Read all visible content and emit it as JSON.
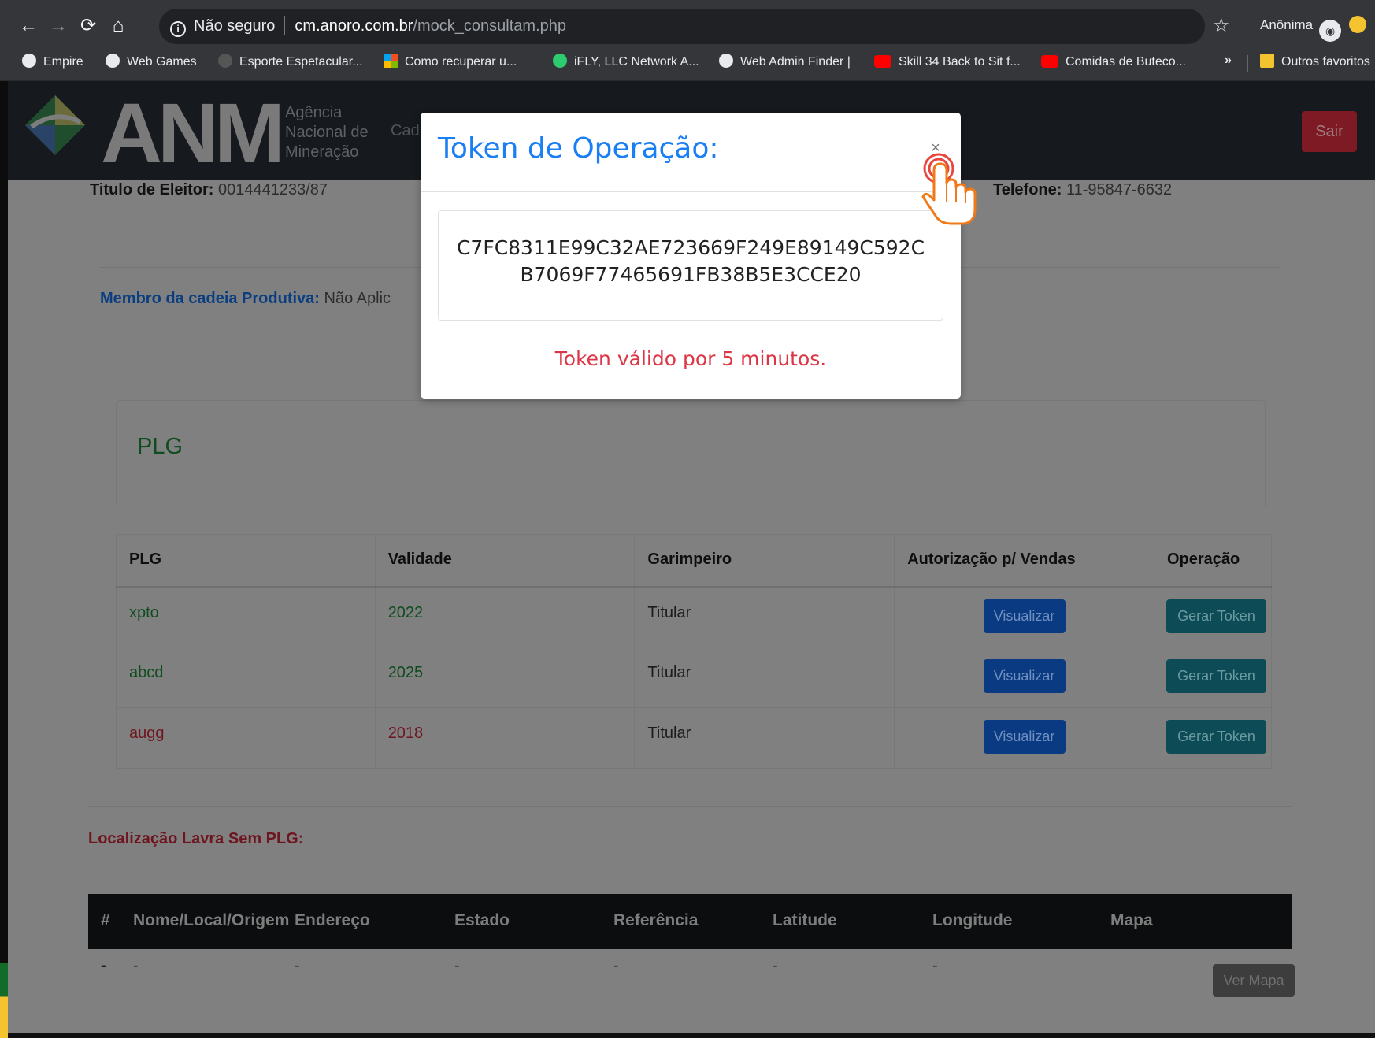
{
  "browser": {
    "omnibox": {
      "security": "Não seguro",
      "host": "cm.anoro.com.br",
      "path": "/mock_consultam.php"
    },
    "profile_label": "Anônima",
    "bookmarks": [
      {
        "label": "Empire",
        "icon": "globe-icon"
      },
      {
        "label": "Web Games",
        "icon": "globe-icon"
      },
      {
        "label": "Esporte Espetacular...",
        "icon": "ball-icon"
      },
      {
        "label": "Como recuperar u...",
        "icon": "microsoft-icon"
      },
      {
        "label": "iFLY, LLC Network A...",
        "icon": "ifly-icon"
      },
      {
        "label": "Web Admin Finder |",
        "icon": "globe-icon"
      },
      {
        "label": "Skill 34 Back to Sit f...",
        "icon": "youtube-icon"
      },
      {
        "label": "Comidas de Buteco...",
        "icon": "youtube-icon"
      }
    ],
    "bookmarks_more": "»",
    "other_bookmarks": "Outros favoritos"
  },
  "site": {
    "logo_text": "ANM",
    "logo_sub": [
      "Agência",
      "Nacional de",
      "Mineração"
    ],
    "nav_partial": "Cad",
    "logout_label": "Sair"
  },
  "profile": {
    "titulo_label": "Titulo de Eleitor:",
    "titulo_value": "0014441233/87",
    "telefone_label": "Telefone:",
    "telefone_value": "11-95847-6632",
    "membro_label": "Membro da cadeia Produtiva:",
    "membro_value": "Não Aplic"
  },
  "plg_section": {
    "title": "PLG",
    "columns": [
      "PLG",
      "Validade",
      "Garimpeiro",
      "Autorização p/ Vendas",
      "Operação"
    ],
    "rows": [
      {
        "plg": "xpto",
        "validade": "2022",
        "garimpeiro": "Titular",
        "status": "green"
      },
      {
        "plg": "abcd",
        "validade": "2025",
        "garimpeiro": "Titular",
        "status": "green"
      },
      {
        "plg": "augg",
        "validade": "2018",
        "garimpeiro": "Titular",
        "status": "red"
      }
    ],
    "view_button": "Visualizar",
    "token_button": "Gerar Token"
  },
  "location_section": {
    "title": "Localização Lavra Sem PLG:",
    "columns": [
      "#",
      "Nome/Local/Origem",
      "Endereço",
      "Estado",
      "Referência",
      "Latitude",
      "Longitude",
      "Mapa"
    ],
    "row": [
      "-",
      "-",
      "-",
      "-",
      "-",
      "-",
      "-"
    ],
    "map_button": "Ver Mapa"
  },
  "modal": {
    "title": "Token de Operação:",
    "close": "×",
    "token": "C7FC8311E99C32AE723669F249E89149C592CB7069F77465691FB38B5E3CCE20",
    "validity": "Token válido por 5 minutos."
  },
  "colors": {
    "modal_title": "#1a7ef4",
    "validity": "#dc3545",
    "valid_row": "#0f4d1f",
    "expired_row": "#6e1620"
  }
}
